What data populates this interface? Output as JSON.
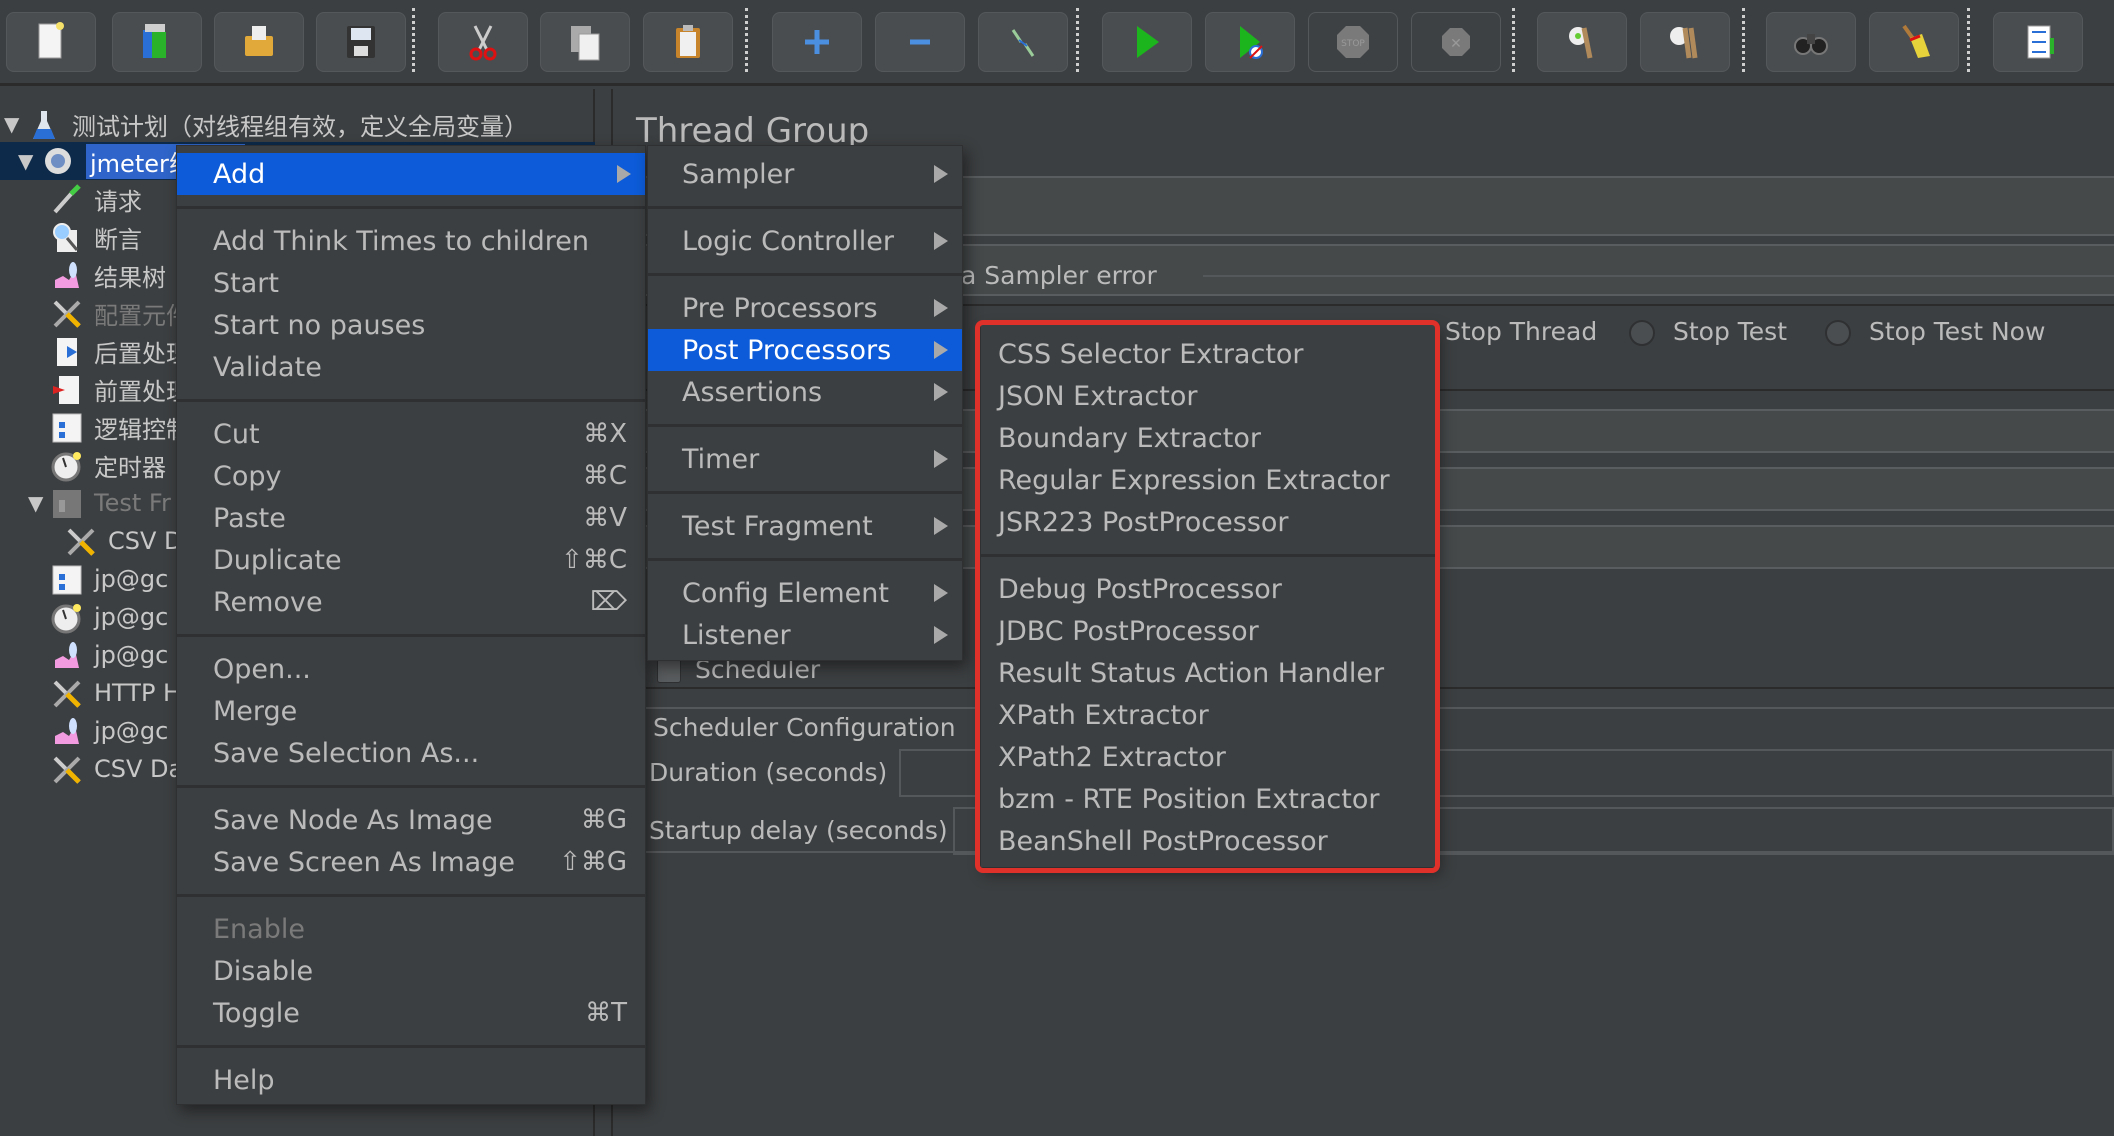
{
  "toolbar": {
    "buttons": [
      {
        "icon": "new-file-icon",
        "label": "New"
      },
      {
        "icon": "templates-icon",
        "label": "Templates"
      },
      {
        "icon": "open-folder-icon",
        "label": "Open"
      },
      {
        "icon": "save-icon",
        "label": "Save"
      },
      {
        "icon": "cut-icon",
        "label": "Cut"
      },
      {
        "icon": "copy-icon",
        "label": "Copy"
      },
      {
        "icon": "paste-icon",
        "label": "Paste"
      },
      {
        "icon": "expand-plus-icon",
        "label": "Expand all"
      },
      {
        "icon": "collapse-minus-icon",
        "label": "Collapse all"
      },
      {
        "icon": "toggle-icon",
        "label": "Toggle"
      },
      {
        "icon": "start-icon",
        "label": "Start"
      },
      {
        "icon": "start-no-pauses-icon",
        "label": "Start no pauses"
      },
      {
        "icon": "stop-icon",
        "label": "Stop"
      },
      {
        "icon": "shutdown-icon",
        "label": "Shutdown"
      },
      {
        "icon": "clear-icon",
        "label": "Clear"
      },
      {
        "icon": "clear-all-icon",
        "label": "Clear all"
      },
      {
        "icon": "search-binoculars-icon",
        "label": "Search"
      },
      {
        "icon": "reset-search-broom-icon",
        "label": "Reset search"
      },
      {
        "icon": "function-helper-icon",
        "label": "Function helper"
      }
    ]
  },
  "tree": {
    "items": [
      {
        "label": "测试计划（对线程组有效，定义全局变量）",
        "icon": "test-plan-flask-icon",
        "level": 0,
        "expanded": true
      },
      {
        "label": "jmeter线程组",
        "icon": "thread-group-gear-icon",
        "level": 0,
        "expanded": true,
        "selected": true
      },
      {
        "label": "请求",
        "icon": "sampler-pipette-icon",
        "level": 1
      },
      {
        "label": "断言",
        "icon": "assertion-magnifier-icon",
        "level": 1
      },
      {
        "label": "结果树",
        "icon": "listener-graph-icon",
        "level": 1
      },
      {
        "label": "配置元件",
        "icon": "config-tools-icon",
        "level": 1,
        "disabled": true
      },
      {
        "label": "后置处理",
        "icon": "post-processor-icon",
        "level": 1
      },
      {
        "label": "前置处理",
        "icon": "pre-processor-icon",
        "level": 1
      },
      {
        "label": "逻辑控制",
        "icon": "logic-controller-icon",
        "level": 1
      },
      {
        "label": "定时器",
        "icon": "timer-clock-icon",
        "level": 1
      },
      {
        "label": "Test Fr",
        "icon": "test-fragment-icon",
        "level": 1,
        "expanded": true,
        "disabled": true
      },
      {
        "label": "CSV D",
        "icon": "config-tools-icon",
        "level": 2
      },
      {
        "label": "jp@gc",
        "icon": "logic-controller-icon",
        "level": 1
      },
      {
        "label": "jp@gc",
        "icon": "timer-clock-icon",
        "level": 1
      },
      {
        "label": "jp@gc",
        "icon": "listener-graph-icon",
        "level": 1
      },
      {
        "label": "HTTP H",
        "icon": "config-tools-icon",
        "level": 1
      },
      {
        "label": "jp@gc",
        "icon": "listener-graph-icon",
        "level": 1
      },
      {
        "label": "CSV Da",
        "icon": "config-tools-icon",
        "level": 1
      }
    ]
  },
  "right_panel": {
    "title": "Thread Group",
    "sampler_error_label": "a Sampler error",
    "radio_options": [
      "Stop Thread",
      "Stop Test",
      "Stop Test Now"
    ],
    "scheduler_label": "Scheduler",
    "scheduler_checked": false,
    "scheduler_config_label": "Scheduler Configuration",
    "duration_label": "Duration (seconds)",
    "duration_value": "",
    "startup_delay_label": "Startup delay (seconds)",
    "startup_delay_value": ""
  },
  "context_menu": {
    "items": [
      {
        "label": "Add",
        "submenu": true,
        "highlighted": true
      },
      {
        "separator": true
      },
      {
        "label": "Add Think Times to children"
      },
      {
        "label": "Start"
      },
      {
        "label": "Start no pauses"
      },
      {
        "label": "Validate"
      },
      {
        "separator": true
      },
      {
        "label": "Cut",
        "shortcut": "⌘X"
      },
      {
        "label": "Copy",
        "shortcut": "⌘C"
      },
      {
        "label": "Paste",
        "shortcut": "⌘V"
      },
      {
        "label": "Duplicate",
        "shortcut": "⇧⌘C"
      },
      {
        "label": "Remove",
        "shortcut": "⌦"
      },
      {
        "separator": true
      },
      {
        "label": "Open..."
      },
      {
        "label": "Merge"
      },
      {
        "label": "Save Selection As..."
      },
      {
        "separator": true
      },
      {
        "label": "Save Node As Image",
        "shortcut": "⌘G"
      },
      {
        "label": "Save Screen As Image",
        "shortcut": "⇧⌘G"
      },
      {
        "separator": true
      },
      {
        "label": "Enable",
        "disabled": true
      },
      {
        "label": "Disable"
      },
      {
        "label": "Toggle",
        "shortcut": "⌘T"
      },
      {
        "separator": true
      },
      {
        "label": "Help"
      }
    ]
  },
  "add_submenu": {
    "items": [
      {
        "label": "Sampler",
        "submenu": true
      },
      {
        "separator": true
      },
      {
        "label": "Logic Controller",
        "submenu": true
      },
      {
        "separator": true
      },
      {
        "label": "Pre Processors",
        "submenu": true
      },
      {
        "label": "Post Processors",
        "submenu": true,
        "highlighted": true
      },
      {
        "label": "Assertions",
        "submenu": true
      },
      {
        "separator": true
      },
      {
        "label": "Timer",
        "submenu": true
      },
      {
        "separator": true
      },
      {
        "label": "Test Fragment",
        "submenu": true
      },
      {
        "separator": true
      },
      {
        "label": "Config Element",
        "submenu": true
      },
      {
        "label": "Listener",
        "submenu": true
      }
    ]
  },
  "post_processors_submenu": {
    "items": [
      {
        "label": "CSS Selector Extractor"
      },
      {
        "label": "JSON Extractor"
      },
      {
        "label": "Boundary Extractor"
      },
      {
        "label": "Regular Expression Extractor"
      },
      {
        "label": "JSR223 PostProcessor"
      },
      {
        "separator": true
      },
      {
        "label": "Debug PostProcessor"
      },
      {
        "label": "JDBC PostProcessor"
      },
      {
        "label": "Result Status Action Handler"
      },
      {
        "label": "XPath Extractor"
      },
      {
        "label": "XPath2 Extractor"
      },
      {
        "label": "bzm - RTE Position Extractor"
      },
      {
        "label": "BeanShell PostProcessor"
      }
    ]
  },
  "colors": {
    "background": "#3c3f41",
    "highlight": "#0d5bd8",
    "annotation_red": "#e0302a",
    "text": "#bbbbbb"
  }
}
